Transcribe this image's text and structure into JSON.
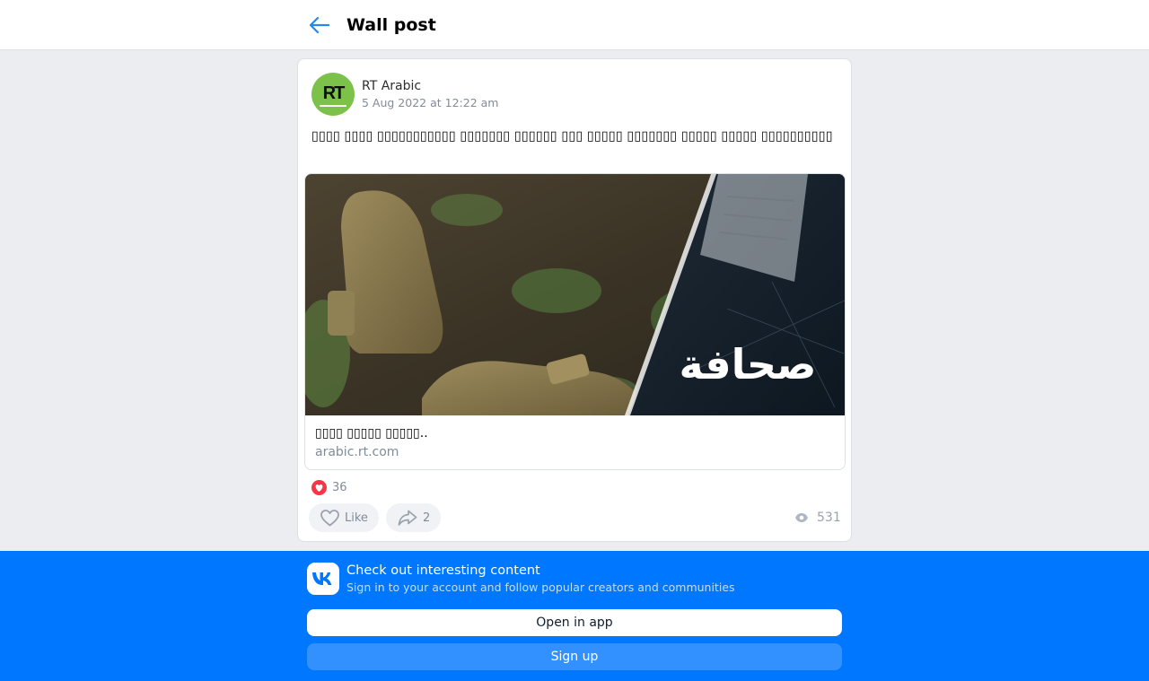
{
  "header": {
    "title": "Wall post",
    "back_icon": "arrow-left-icon"
  },
  "post": {
    "author": "RT Arabic",
    "date": "5 Aug 2022 at 12:22 am",
    "text": "▯▯▯▯ ▯▯▯▯ ▯▯▯▯▯▯▯▯▯▯▯ ▯▯▯▯▯▯▯ ▯▯▯▯▯▯ ▯▯▯ ▯▯▯▯▯ ▯▯▯▯▯▯▯ ▯▯▯▯▯ ▯▯▯▯▯ ▯▯▯▯▯▯▯▯▯▯",
    "link": {
      "title": "▯▯▯▯ ▯▯▯▯▯ ▯▯▯▯▯..",
      "domain": "arabic.rt.com",
      "image_caption": "صحافة"
    },
    "reactions": {
      "count": "36",
      "icon": "heart-reaction-icon",
      "color": "#ff3347"
    },
    "actions": {
      "like_label": "Like",
      "share_count": "2",
      "views_count": "531"
    }
  },
  "banner": {
    "title": "Check out interesting content",
    "subtitle": "Sign in to your account and follow popular creators and communities",
    "open_app_label": "Open in app",
    "signup_label": "Sign up",
    "accent": "#0077ff"
  }
}
